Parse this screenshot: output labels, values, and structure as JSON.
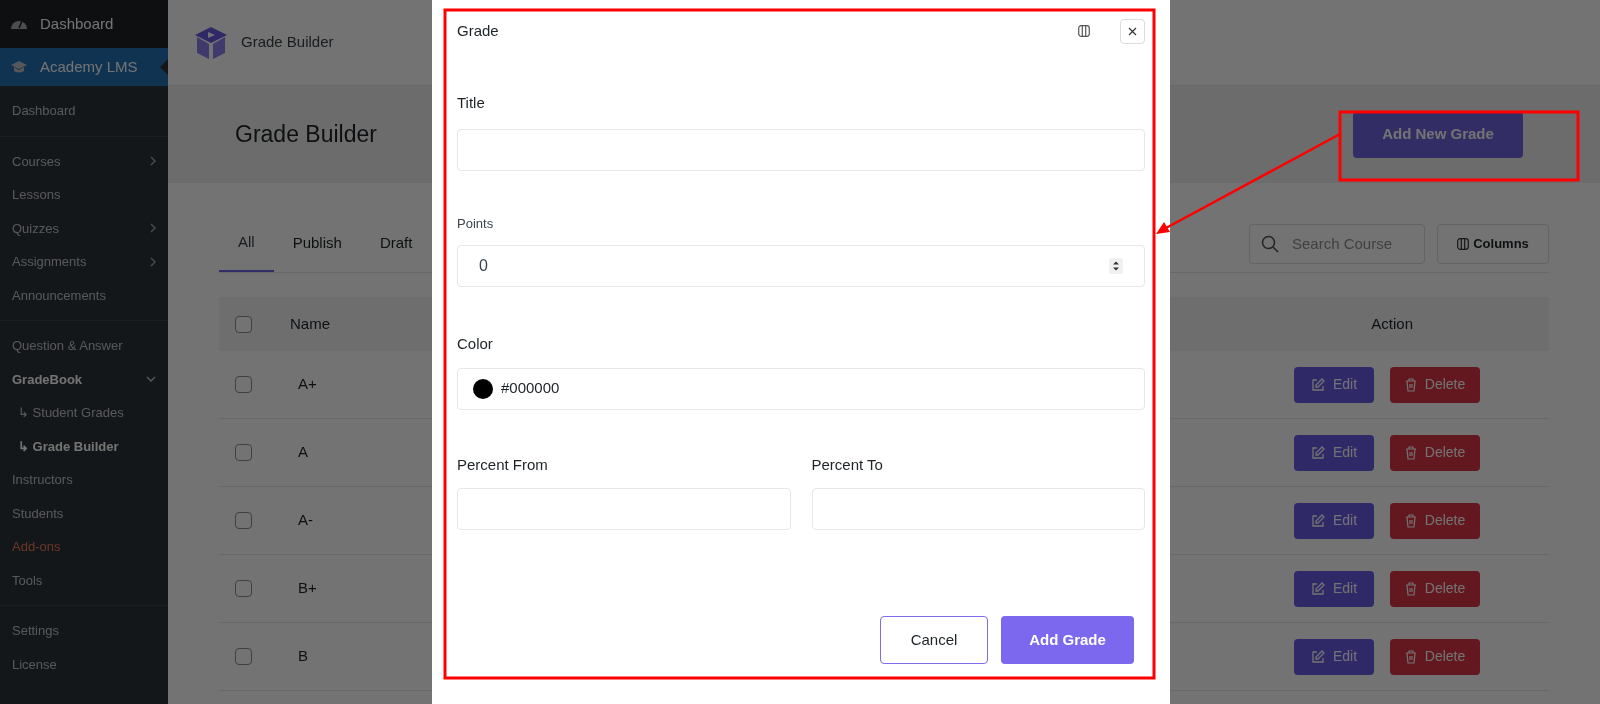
{
  "sidebar": {
    "top_items": [
      {
        "label": "Dashboard",
        "selected": false
      },
      {
        "label": "Academy LMS",
        "selected": true
      }
    ],
    "menu_groups": [
      [
        {
          "label": "Dashboard",
          "kind": "item",
          "selected": false
        }
      ],
      [
        {
          "label": "Courses",
          "kind": "parent",
          "selected": false
        },
        {
          "label": "Lessons",
          "kind": "item",
          "selected": false
        },
        {
          "label": "Quizzes",
          "kind": "parent",
          "selected": false
        },
        {
          "label": "Assignments",
          "kind": "parent",
          "selected": false
        },
        {
          "label": "Announcements",
          "kind": "item",
          "selected": false
        }
      ],
      [
        {
          "label": "Question & Answer",
          "kind": "item",
          "selected": false
        },
        {
          "label": "GradeBook",
          "kind": "open",
          "selected": true
        },
        {
          "label": "↳ Student Grades",
          "kind": "sub",
          "selected": false
        },
        {
          "label": "↳ Grade Builder",
          "kind": "sub",
          "selected": true
        },
        {
          "label": "Instructors",
          "kind": "item",
          "selected": false
        },
        {
          "label": "Students",
          "kind": "item",
          "selected": false
        },
        {
          "label": "Add-ons",
          "kind": "item",
          "accent": true,
          "selected": false
        },
        {
          "label": "Tools",
          "kind": "item",
          "selected": false
        }
      ],
      [
        {
          "label": "Settings",
          "kind": "item",
          "selected": false
        },
        {
          "label": "License",
          "kind": "item",
          "selected": false
        }
      ]
    ]
  },
  "header": {
    "title": "Grade Builder"
  },
  "page": {
    "title": "Grade Builder",
    "add_button": "Add New Grade"
  },
  "tabs": [
    {
      "label": "All",
      "selected": true
    },
    {
      "label": "Publish",
      "selected": false
    },
    {
      "label": "Draft",
      "selected": false
    }
  ],
  "search": {
    "placeholder": "Search Course"
  },
  "columns_button": "Columns",
  "table": {
    "columns": [
      "Name",
      "Action"
    ],
    "header_checked": false,
    "rows": [
      {
        "name": "A+",
        "checked": false,
        "edit": "Edit",
        "delete": "Delete"
      },
      {
        "name": "A",
        "checked": false,
        "edit": "Edit",
        "delete": "Delete"
      },
      {
        "name": "A-",
        "checked": false,
        "edit": "Edit",
        "delete": "Delete"
      },
      {
        "name": "B+",
        "checked": false,
        "edit": "Edit",
        "delete": "Delete"
      },
      {
        "name": "B",
        "checked": false,
        "edit": "Edit",
        "delete": "Delete"
      }
    ]
  },
  "modal": {
    "title": "Grade",
    "title_label": "Title",
    "points_label": "Points",
    "points_value": "0",
    "color_label": "Color",
    "color_value": "#000000",
    "color": "#000000",
    "percent_from_label": "Percent From",
    "percent_to_label": "Percent To",
    "cancel": "Cancel",
    "submit": "Add Grade"
  }
}
